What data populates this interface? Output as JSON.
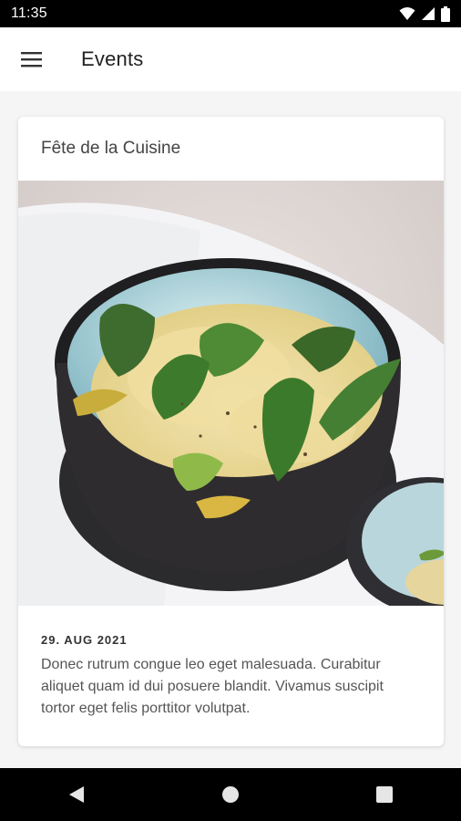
{
  "status_bar": {
    "time": "11:35",
    "icons": [
      "wifi-icon",
      "signal-icon",
      "battery-icon"
    ]
  },
  "app_bar": {
    "menu_icon": "hamburger-menu-icon",
    "title": "Events"
  },
  "event_card": {
    "title": "Fête de la Cuisine",
    "image_subject": "food-bowl-image",
    "date": "29. AUG 2021",
    "description": "Donec rutrum congue leo eget malesuada. Curabitur aliquet quam id dui posuere blandit. Vivamus suscipit tortor eget felis porttitor volutpat."
  },
  "nav_bar": {
    "buttons": [
      "back-icon",
      "home-icon",
      "recents-icon"
    ]
  },
  "colors": {
    "status_bar": "#000000",
    "app_bar": "#ffffff",
    "background": "#f5f5f5"
  }
}
